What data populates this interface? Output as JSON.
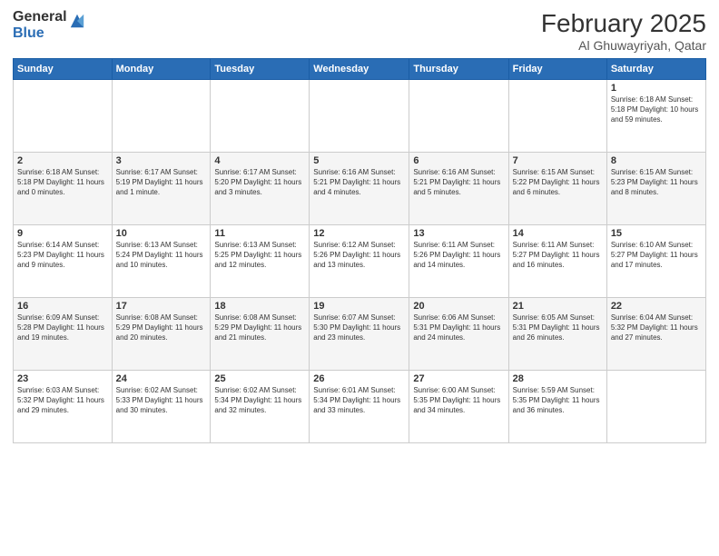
{
  "logo": {
    "general": "General",
    "blue": "Blue"
  },
  "header": {
    "month": "February 2025",
    "location": "Al Ghuwayriyah, Qatar"
  },
  "weekdays": [
    "Sunday",
    "Monday",
    "Tuesday",
    "Wednesday",
    "Thursday",
    "Friday",
    "Saturday"
  ],
  "weeks": [
    [
      {
        "day": "",
        "info": ""
      },
      {
        "day": "",
        "info": ""
      },
      {
        "day": "",
        "info": ""
      },
      {
        "day": "",
        "info": ""
      },
      {
        "day": "",
        "info": ""
      },
      {
        "day": "",
        "info": ""
      },
      {
        "day": "1",
        "info": "Sunrise: 6:18 AM\nSunset: 5:18 PM\nDaylight: 10 hours\nand 59 minutes."
      }
    ],
    [
      {
        "day": "2",
        "info": "Sunrise: 6:18 AM\nSunset: 5:18 PM\nDaylight: 11 hours\nand 0 minutes."
      },
      {
        "day": "3",
        "info": "Sunrise: 6:17 AM\nSunset: 5:19 PM\nDaylight: 11 hours\nand 1 minute."
      },
      {
        "day": "4",
        "info": "Sunrise: 6:17 AM\nSunset: 5:20 PM\nDaylight: 11 hours\nand 3 minutes."
      },
      {
        "day": "5",
        "info": "Sunrise: 6:16 AM\nSunset: 5:21 PM\nDaylight: 11 hours\nand 4 minutes."
      },
      {
        "day": "6",
        "info": "Sunrise: 6:16 AM\nSunset: 5:21 PM\nDaylight: 11 hours\nand 5 minutes."
      },
      {
        "day": "7",
        "info": "Sunrise: 6:15 AM\nSunset: 5:22 PM\nDaylight: 11 hours\nand 6 minutes."
      },
      {
        "day": "8",
        "info": "Sunrise: 6:15 AM\nSunset: 5:23 PM\nDaylight: 11 hours\nand 8 minutes."
      }
    ],
    [
      {
        "day": "9",
        "info": "Sunrise: 6:14 AM\nSunset: 5:23 PM\nDaylight: 11 hours\nand 9 minutes."
      },
      {
        "day": "10",
        "info": "Sunrise: 6:13 AM\nSunset: 5:24 PM\nDaylight: 11 hours\nand 10 minutes."
      },
      {
        "day": "11",
        "info": "Sunrise: 6:13 AM\nSunset: 5:25 PM\nDaylight: 11 hours\nand 12 minutes."
      },
      {
        "day": "12",
        "info": "Sunrise: 6:12 AM\nSunset: 5:26 PM\nDaylight: 11 hours\nand 13 minutes."
      },
      {
        "day": "13",
        "info": "Sunrise: 6:11 AM\nSunset: 5:26 PM\nDaylight: 11 hours\nand 14 minutes."
      },
      {
        "day": "14",
        "info": "Sunrise: 6:11 AM\nSunset: 5:27 PM\nDaylight: 11 hours\nand 16 minutes."
      },
      {
        "day": "15",
        "info": "Sunrise: 6:10 AM\nSunset: 5:27 PM\nDaylight: 11 hours\nand 17 minutes."
      }
    ],
    [
      {
        "day": "16",
        "info": "Sunrise: 6:09 AM\nSunset: 5:28 PM\nDaylight: 11 hours\nand 19 minutes."
      },
      {
        "day": "17",
        "info": "Sunrise: 6:08 AM\nSunset: 5:29 PM\nDaylight: 11 hours\nand 20 minutes."
      },
      {
        "day": "18",
        "info": "Sunrise: 6:08 AM\nSunset: 5:29 PM\nDaylight: 11 hours\nand 21 minutes."
      },
      {
        "day": "19",
        "info": "Sunrise: 6:07 AM\nSunset: 5:30 PM\nDaylight: 11 hours\nand 23 minutes."
      },
      {
        "day": "20",
        "info": "Sunrise: 6:06 AM\nSunset: 5:31 PM\nDaylight: 11 hours\nand 24 minutes."
      },
      {
        "day": "21",
        "info": "Sunrise: 6:05 AM\nSunset: 5:31 PM\nDaylight: 11 hours\nand 26 minutes."
      },
      {
        "day": "22",
        "info": "Sunrise: 6:04 AM\nSunset: 5:32 PM\nDaylight: 11 hours\nand 27 minutes."
      }
    ],
    [
      {
        "day": "23",
        "info": "Sunrise: 6:03 AM\nSunset: 5:32 PM\nDaylight: 11 hours\nand 29 minutes."
      },
      {
        "day": "24",
        "info": "Sunrise: 6:02 AM\nSunset: 5:33 PM\nDaylight: 11 hours\nand 30 minutes."
      },
      {
        "day": "25",
        "info": "Sunrise: 6:02 AM\nSunset: 5:34 PM\nDaylight: 11 hours\nand 32 minutes."
      },
      {
        "day": "26",
        "info": "Sunrise: 6:01 AM\nSunset: 5:34 PM\nDaylight: 11 hours\nand 33 minutes."
      },
      {
        "day": "27",
        "info": "Sunrise: 6:00 AM\nSunset: 5:35 PM\nDaylight: 11 hours\nand 34 minutes."
      },
      {
        "day": "28",
        "info": "Sunrise: 5:59 AM\nSunset: 5:35 PM\nDaylight: 11 hours\nand 36 minutes."
      },
      {
        "day": "",
        "info": ""
      }
    ]
  ]
}
